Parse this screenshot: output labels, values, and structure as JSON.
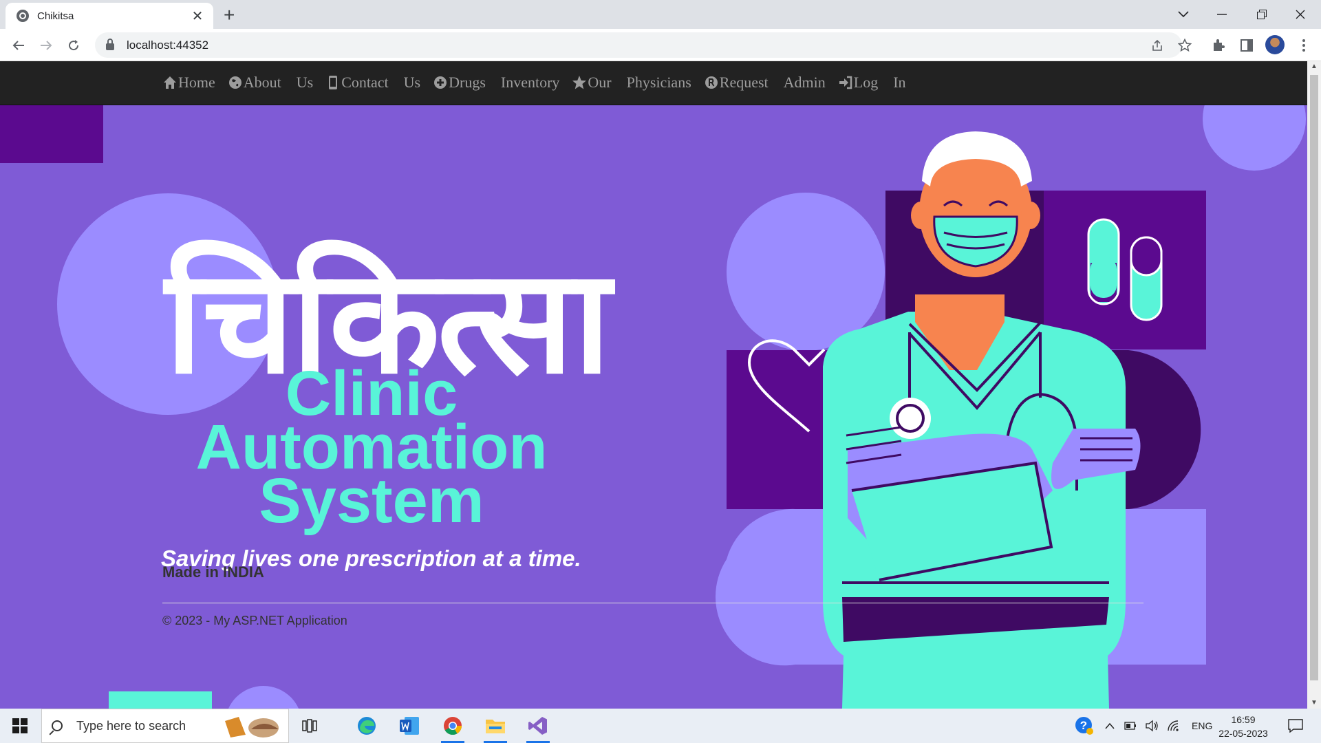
{
  "browser": {
    "tab_title": "Chikitsa",
    "tab_close": "✕",
    "new_tab": "+",
    "url": "localhost:44352"
  },
  "nav": {
    "home": "Home",
    "about_1": "About",
    "about_2": "Us",
    "contact_1": "Contact",
    "contact_2": "Us",
    "drugs_1": "Drugs",
    "drugs_2": "Inventory",
    "physicians_1": "Our",
    "physicians_2": "Physicians",
    "request_1": "Request",
    "request_2": "Admin",
    "login_1": "Log",
    "login_2": "In"
  },
  "hero": {
    "title_devanagari": "चिकित्सा",
    "subtitle_line1": "Clinic",
    "subtitle_line2": "Automation",
    "subtitle_line3": "System",
    "tagline": "Saving lives one prescription at a time."
  },
  "footer": {
    "made_in": "Made in INDIA",
    "copyright": "© 2023 - My ASP.NET Application"
  },
  "taskbar": {
    "search_placeholder": "Type here to search",
    "language": "ENG",
    "time": "16:59",
    "date": "22-05-2023"
  },
  "colors": {
    "page_bg": "#7f5bd6",
    "accent_teal": "#59f4d8",
    "dark_purple": "#5b0a8f",
    "light_lavender": "#9b8cff",
    "navbar": "#222222"
  }
}
